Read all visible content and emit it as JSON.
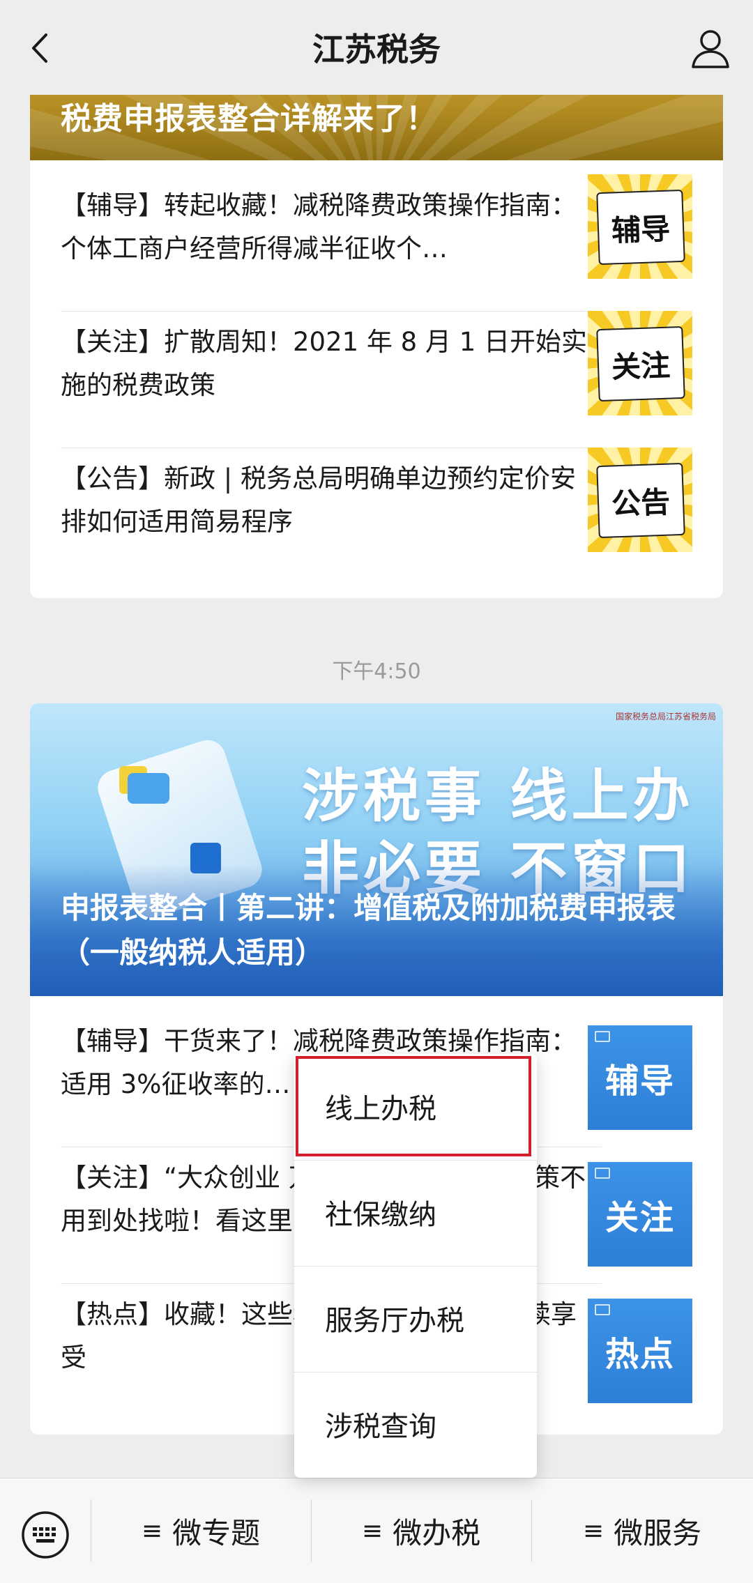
{
  "header": {
    "title": "江苏税务"
  },
  "card1": {
    "banner_title": "税费申报表整合详解来了！",
    "items": [
      {
        "text": "【辅导】转起收藏！减税降费政策操作指南：个体工商户经营所得减半征收个…",
        "thumb_label": "辅导"
      },
      {
        "text": "【关注】扩散周知！2021 年 8 月 1 日开始实施的税费政策",
        "thumb_label": "关注"
      },
      {
        "text": "【公告】新政 | 税务总局明确单边预约定价安排如何适用简易程序",
        "thumb_label": "公告"
      }
    ]
  },
  "timestamp": "下午4:50",
  "card2": {
    "banner_line1": "涉税事  线上办",
    "banner_line2": "非必要  不窗口",
    "banner_caption": "申报表整合丨第二讲：增值税及附加税费申报表（一般纳税人适用）",
    "agency_text": "国家税务总局江苏省税务局",
    "items": [
      {
        "text": "【辅导】干货来了！减税降费政策操作指南：适用 3%征收率的…",
        "thumb_label": "辅导"
      },
      {
        "text": "【关注】“大众创业 万众创新”税费优惠政策不用到处找啦！看这里…",
        "thumb_label": "关注"
      },
      {
        "text": "【热点】收藏！这些税费优惠政策可以延续享受",
        "thumb_label": "热点"
      }
    ]
  },
  "popup_menu": {
    "items": [
      "线上办税",
      "社保缴纳",
      "服务厅办税",
      "涉税查询"
    ],
    "highlighted_index": 0,
    "highlight_color": "#d21f2b"
  },
  "bottom_menu": {
    "items": [
      "微专题",
      "微办税",
      "微服务"
    ],
    "keyboard_icon": "keyboard-icon"
  },
  "colors": {
    "background": "#ededed",
    "banner1_gold": "#b38d22",
    "thumb_yellow": "#f6c924",
    "thumb_blue": "#2e7fd6"
  }
}
